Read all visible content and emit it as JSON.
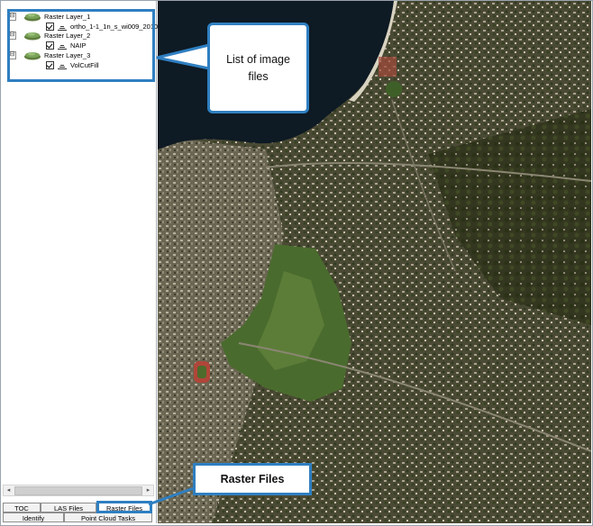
{
  "toc": {
    "layers": [
      {
        "name": "Raster Layer_1",
        "file": "ortho_1-1_1n_s_wi009_2010_"
      },
      {
        "name": "Raster Layer_2",
        "file": "NAIP"
      },
      {
        "name": "Raster Layer_3",
        "file": "VolCutFill"
      }
    ],
    "expander_symbol": "⊟"
  },
  "scrollbar": {
    "left_arrow": "◂",
    "right_arrow": "▸"
  },
  "tabs": {
    "row1": [
      "TOC",
      "LAS Files",
      "Raster Files"
    ],
    "row2": [
      "Identify",
      "Point Cloud Tasks"
    ],
    "active": "Raster Files"
  },
  "callouts": {
    "image_list": "List of image files",
    "raster_files": "Raster Files"
  },
  "colors": {
    "accent": "#2f7fc1",
    "ocean": "#0e1a24",
    "vegetation": "#4a6b2e"
  },
  "icons": {
    "layer": "layer-stack-icon",
    "checkbox": "checkbox-checked-icon",
    "raster": "raster-ramp-icon"
  }
}
